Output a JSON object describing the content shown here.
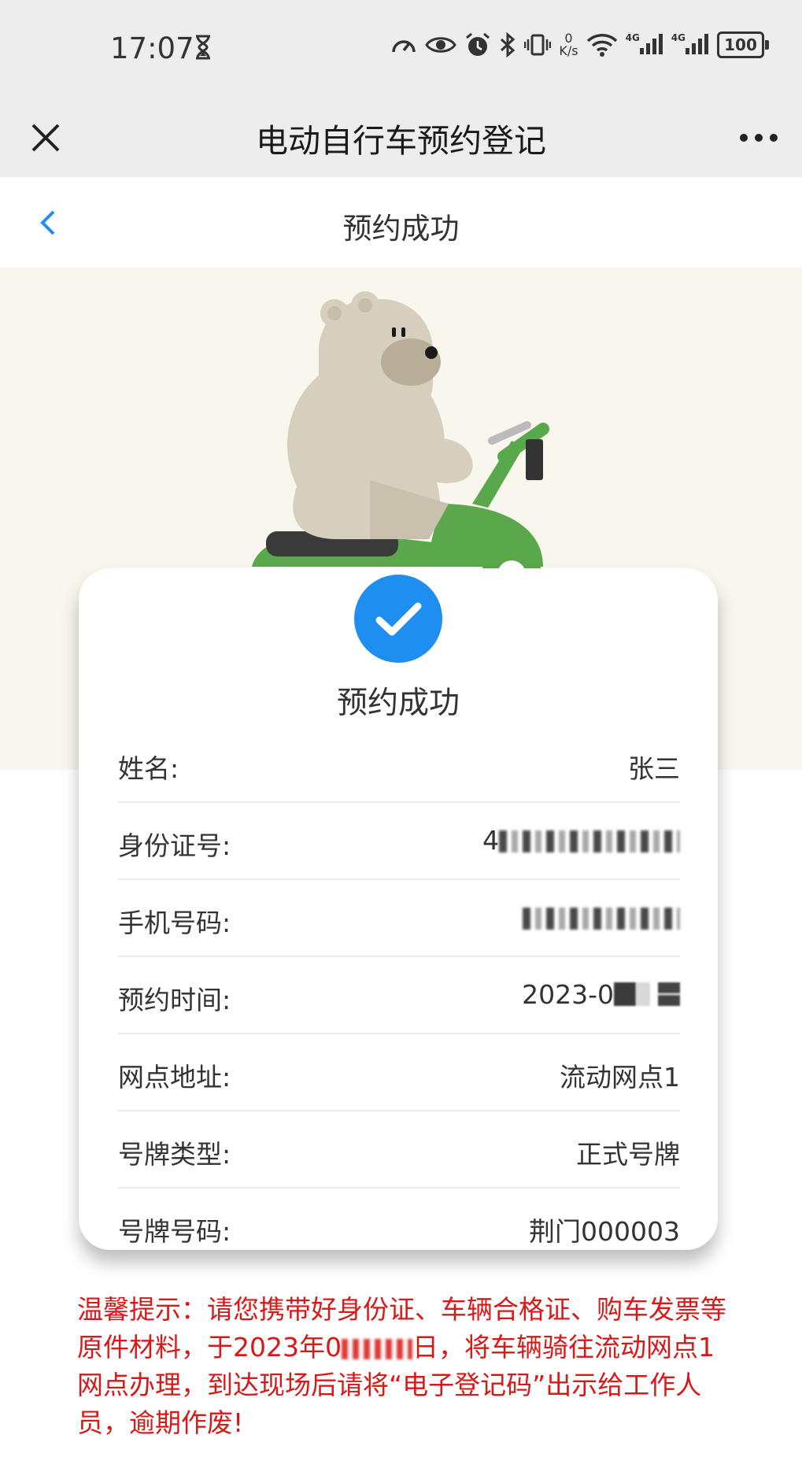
{
  "status_bar": {
    "time": "17:07",
    "speed_top": "0",
    "speed_unit": "K/s",
    "net1": "4G",
    "net2": "4G",
    "battery": "100"
  },
  "app_bar": {
    "title": "电动自行车预约登记"
  },
  "page_header": {
    "title": "预约成功"
  },
  "card": {
    "title": "预约成功",
    "rows": [
      {
        "label": "姓名:",
        "value": "张三"
      },
      {
        "label": "身份证号:",
        "value": "4"
      },
      {
        "label": "手机号码:",
        "value": ""
      },
      {
        "label": "预约时间:",
        "value": "2023-0"
      },
      {
        "label": "网点地址:",
        "value": "流动网点1"
      },
      {
        "label": "号牌类型:",
        "value": "正式号牌"
      },
      {
        "label": "号牌号码:",
        "value": "荆门000003"
      }
    ]
  },
  "notice": {
    "text_part1": "温馨提示：请您携带好身份证、车辆合格证、购车发票等原件材料，于2023年0",
    "text_part2": "日，将车辆骑往流动网点1网点办理，到达现场后请将“电子登记码”出示给工作人员，逾期作废!"
  },
  "colors": {
    "accent": "#1e8ef0",
    "notice_red": "#d91818",
    "highlight_red": "#d0103a",
    "hero_bg": "#f8f6ed",
    "scooter_green": "#5aa84c"
  }
}
